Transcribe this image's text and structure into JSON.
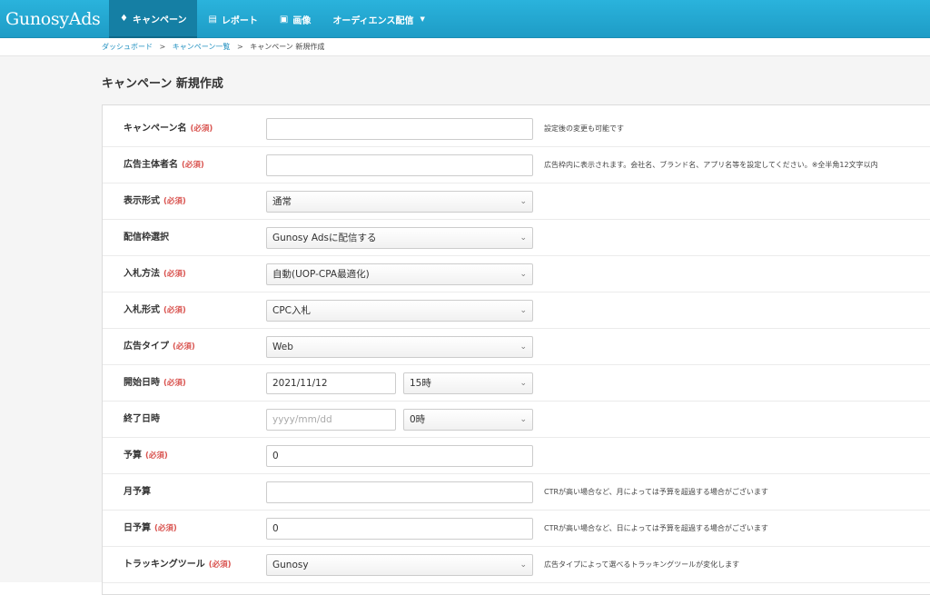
{
  "brand": "GunosyAds",
  "nav": {
    "items": [
      {
        "label": "キャンペーン",
        "icon": "tag-icon"
      },
      {
        "label": "レポート",
        "icon": "chart-icon"
      },
      {
        "label": "画像",
        "icon": "image-icon"
      },
      {
        "label": "オーディエンス配信",
        "icon": ""
      }
    ]
  },
  "breadcrumb": {
    "dashboard": "ダッシュボード",
    "campaign_list": "キャンペーン一覧",
    "current": "キャンペーン 新規作成",
    "separator": ">"
  },
  "page_title": "キャンペーン 新規作成",
  "required_label": "(必須)",
  "form": {
    "campaign_name": {
      "label": "キャンペーン名",
      "value": "",
      "help": "設定後の変更も可能です"
    },
    "advertiser_name": {
      "label": "広告主体者名",
      "value": "",
      "help": "広告枠内に表示されます。会社名、ブランド名、アプリ名等を設定してください。※全半角12文字以内"
    },
    "display_format": {
      "label": "表示形式",
      "value": "通常"
    },
    "placement": {
      "label": "配信枠選択",
      "value": "Gunosy Adsに配信する"
    },
    "bid_method": {
      "label": "入札方法",
      "value": "自動(UOP-CPA最適化)"
    },
    "bid_type": {
      "label": "入札形式",
      "value": "CPC入札"
    },
    "ad_type": {
      "label": "広告タイプ",
      "value": "Web"
    },
    "start_datetime": {
      "label": "開始日時",
      "date": "2021/11/12",
      "hour": "15時"
    },
    "end_datetime": {
      "label": "終了日時",
      "date_placeholder": "yyyy/mm/dd",
      "hour": "0時"
    },
    "budget": {
      "label": "予算",
      "value": "0"
    },
    "monthly_budget": {
      "label": "月予算",
      "value": "",
      "help": "CTRが高い場合など、月によっては予算を超過する場合がございます"
    },
    "daily_budget": {
      "label": "日予算",
      "value": "0",
      "help": "CTRが高い場合など、日によっては予算を超過する場合がございます"
    },
    "tracking_tool": {
      "label": "トラッキングツール",
      "value": "Gunosy",
      "help": "広告タイプによって選べるトラッキングツールが変化します"
    }
  },
  "colors": {
    "navbar": "#1e9cc6",
    "active_nav": "#157fa4",
    "required": "#d9534f",
    "link": "#1f8fc0"
  }
}
